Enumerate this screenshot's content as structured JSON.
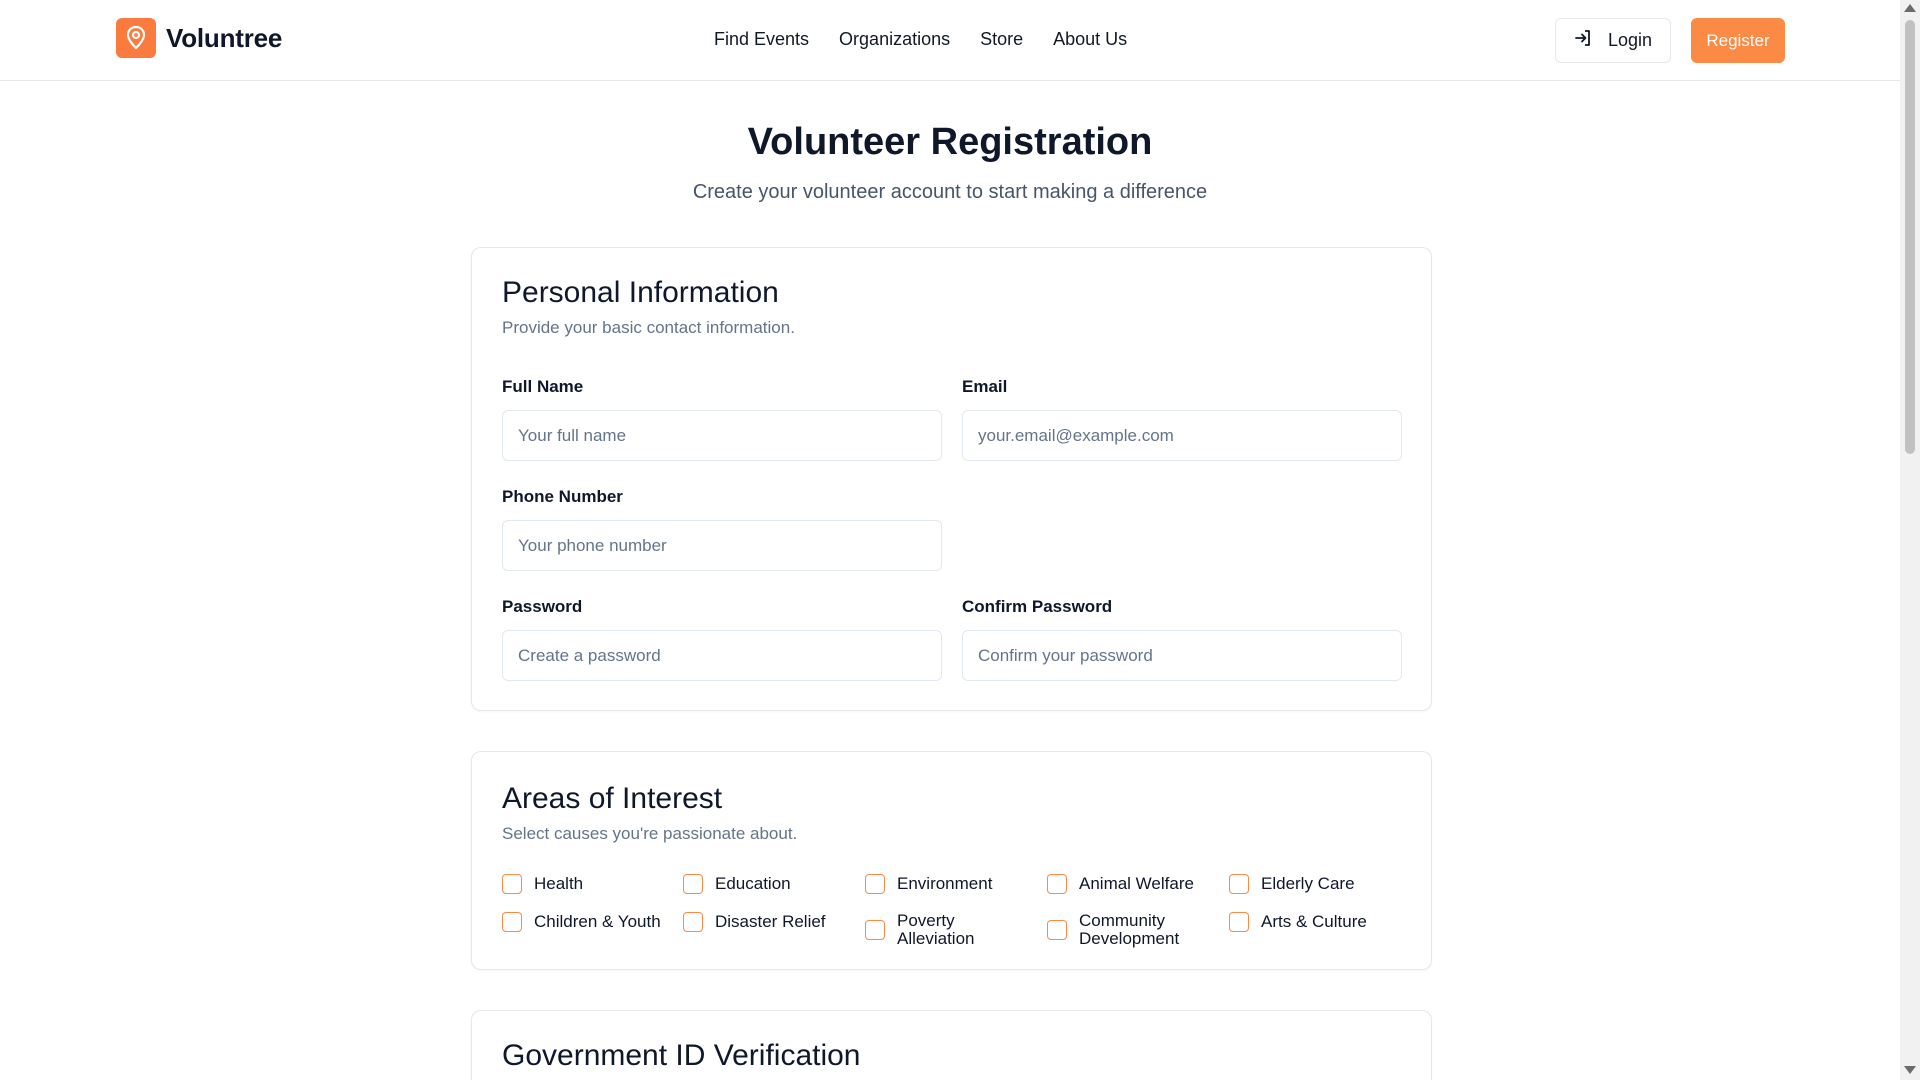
{
  "brand": {
    "name": "Voluntree",
    "logo_icon": "map-pin-icon",
    "accent": "#fb7b3f"
  },
  "nav": {
    "items": [
      {
        "label": "Find Events"
      },
      {
        "label": "Organizations"
      },
      {
        "label": "Store"
      },
      {
        "label": "About Us"
      }
    ]
  },
  "auth": {
    "login_label": "Login",
    "login_icon": "login-arrow-icon",
    "register_label": "Register",
    "register_color": "#fb8a44"
  },
  "page": {
    "title": "Volunteer Registration",
    "subtitle": "Create your volunteer account to start making a difference"
  },
  "personal": {
    "title": "Personal Information",
    "description": "Provide your basic contact information.",
    "full_name": {
      "label": "Full Name",
      "placeholder": "Your full name",
      "value": ""
    },
    "email": {
      "label": "Email",
      "placeholder": "your.email@example.com",
      "value": ""
    },
    "phone": {
      "label": "Phone Number",
      "placeholder": "Your phone number",
      "value": ""
    },
    "password": {
      "label": "Password",
      "placeholder": "Create a password",
      "value": ""
    },
    "confirm_password": {
      "label": "Confirm Password",
      "placeholder": "Confirm your password",
      "value": ""
    }
  },
  "interests": {
    "title": "Areas of Interest",
    "description": "Select causes you're passionate about.",
    "items": [
      {
        "label": "Health",
        "checked": false
      },
      {
        "label": "Education",
        "checked": false
      },
      {
        "label": "Environment",
        "checked": false
      },
      {
        "label": "Animal Welfare",
        "checked": false
      },
      {
        "label": "Elderly Care",
        "checked": false
      },
      {
        "label": "Children & Youth",
        "checked": false
      },
      {
        "label": "Disaster Relief",
        "checked": false
      },
      {
        "label": "Poverty Alleviation",
        "checked": false
      },
      {
        "label": "Community Development",
        "checked": false
      },
      {
        "label": "Arts & Culture",
        "checked": false
      }
    ]
  },
  "government_id": {
    "title": "Government ID Verification"
  }
}
